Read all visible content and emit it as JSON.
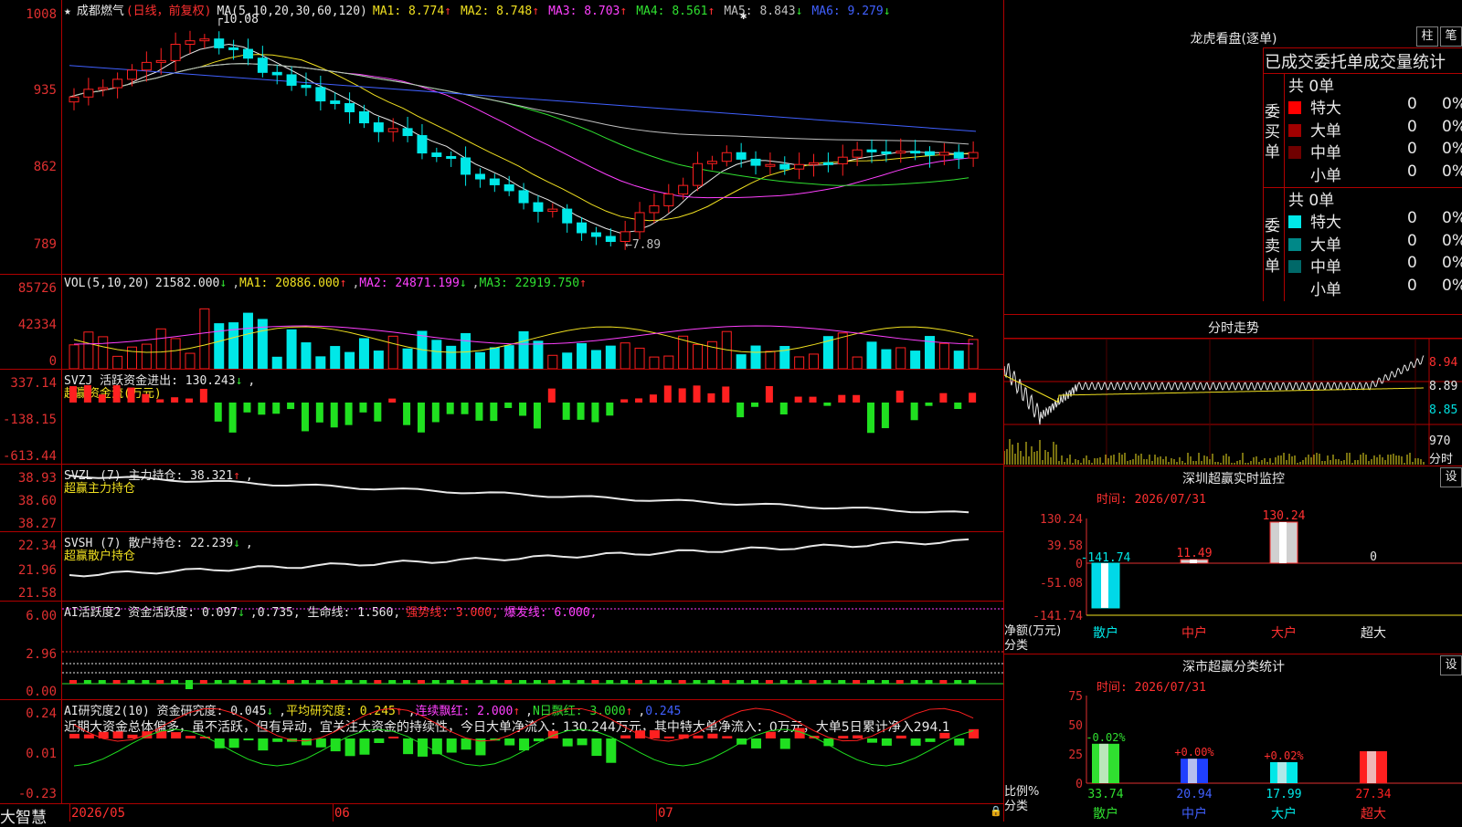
{
  "stock": {
    "name": "成都燃气",
    "mode": "(日线，前复权)",
    "ma_prefix": "MA(5,10,20,30,60,120)",
    "ma": [
      {
        "label": "MA1:",
        "value": "8.774",
        "arrow": "↑",
        "color": "#f0e020"
      },
      {
        "label": "MA2:",
        "value": "8.748",
        "arrow": "↑",
        "color": "#f0e020"
      },
      {
        "label": "MA3:",
        "value": "8.703",
        "arrow": "↑",
        "color": "#ff40ff"
      },
      {
        "label": "MA4:",
        "value": "8.561",
        "arrow": "↑",
        "color": "#30e030"
      },
      {
        "label": "MA5:",
        "value": "8.843",
        "arrow": "↓",
        "color": "#c0c0c0"
      },
      {
        "label": "MA6:",
        "value": "9.279",
        "arrow": "↓",
        "color": "#4060ff"
      }
    ],
    "high_label": "10.08",
    "low_label": "←7.89"
  },
  "price_axis": [
    "1008",
    "935",
    "862",
    "789"
  ],
  "vol": {
    "header": "VOL(5,10,20)",
    "value": "21582.000",
    "ma1": "MA1: 20886.000",
    "ma2": "MA2: 24871.199",
    "ma3": "MA3: 22919.750",
    "axis": [
      "85726",
      "42334",
      "0"
    ]
  },
  "svzj": {
    "header": "SVZJ  活跃资金进出: 130.243",
    "sub": "超赢资金流(万元)",
    "axis": [
      "337.14",
      "-138.15",
      "-613.44"
    ]
  },
  "svzl": {
    "header": "SVZL (7) 主力持仓: 38.321",
    "sub": "超赢主力持仓",
    "axis": [
      "38.93",
      "38.60",
      "38.27"
    ]
  },
  "svsh": {
    "header": "SVSH (7) 散户持仓: 22.239",
    "sub": "超赢散户持仓",
    "axis": [
      "22.34",
      "21.96",
      "21.58"
    ]
  },
  "ai1": {
    "header_a": "AI活跃度2 资金活跃度: 0.097",
    "header_b": "0.735, 生命线: 1.560,",
    "strong": "强势线: 3.000,",
    "burst": "爆发线: 6.000,",
    "axis": [
      "6.00",
      "2.96",
      "0.00"
    ]
  },
  "ai2": {
    "header_a": "AI研究度2(10) 资金研究度: 0.045",
    "avg": "平均研究度: 0.245",
    "cont": "连续飘红: 2.000",
    "nday": "N日飘红: 3.000",
    "last": "0.245",
    "text": "近期大资金总体偏多，虽不活跃，但有异动，宜关注大资金的持续性，今日大单净流入：130.244万元，其中特大单净流入：0万元，大单5日累计净入294.1",
    "axis": [
      "0.24",
      "0.01",
      "-0.23"
    ]
  },
  "bottom": {
    "brand": "大智慧",
    "dates": [
      "2026/05",
      "06",
      "07"
    ]
  },
  "dragon": {
    "title": "龙虎看盘(逐单)",
    "btn1": "柱",
    "btn2": "笔",
    "subtitle": "已成交委托单成交量统计",
    "buy_label": "委买单",
    "sell_label": "委卖单",
    "buy_total": "共 0单",
    "sell_total": "共 0单",
    "buy_rows": [
      {
        "name": "特大",
        "val": "0",
        "pct": "0%",
        "color": "#ff0000"
      },
      {
        "name": "大单",
        "val": "0",
        "pct": "0%",
        "color": "#a00000"
      },
      {
        "name": "中单",
        "val": "0",
        "pct": "0%",
        "color": "#700000"
      },
      {
        "name": "小单",
        "val": "0",
        "pct": "0%",
        "color": ""
      }
    ],
    "sell_rows": [
      {
        "name": "特大",
        "val": "0",
        "pct": "0%",
        "color": "#00e8e8"
      },
      {
        "name": "大单",
        "val": "0",
        "pct": "0%",
        "color": "#008888"
      },
      {
        "name": "中单",
        "val": "0",
        "pct": "0%",
        "color": "#006868"
      },
      {
        "name": "小单",
        "val": "0",
        "pct": "0%",
        "color": ""
      }
    ]
  },
  "intraday": {
    "title": "分时走势",
    "axis": [
      "8.94",
      "8.89",
      "8.85"
    ],
    "vol_label": "970",
    "vol_unit": "分时"
  },
  "sz_monitor": {
    "title": "深圳超赢实时监控",
    "btn": "设",
    "time": "时间: 2026/07/31",
    "axis": [
      "130.24",
      "39.58",
      "0",
      "-51.08",
      "-141.74"
    ],
    "y_label_1": "净额(万元)",
    "y_label_2": "分类",
    "cats": [
      "散户",
      "中户",
      "大户",
      "超大"
    ],
    "values": [
      "-141.74",
      "11.49",
      "130.24",
      "0"
    ]
  },
  "sz_class": {
    "title": "深市超赢分类统计",
    "btn": "设",
    "time": "时间: 2026/07/31",
    "axis": [
      "75",
      "50",
      "25",
      "0"
    ],
    "y_label_1": "比例%",
    "y_label_2": "分类",
    "cats": [
      "散户",
      "中户",
      "大户",
      "超大"
    ],
    "top_labels": [
      "-0.02%",
      "+0.00%",
      "+0.02%",
      ""
    ],
    "values": [
      "33.74",
      "20.94",
      "17.99",
      "27.34"
    ]
  },
  "chart_data": [
    {
      "type": "candlestick",
      "title": "成都燃气",
      "ylim": [
        7.6,
        10.2
      ],
      "yticks": [
        "1008",
        "935",
        "862",
        "789"
      ],
      "x_ticks": [
        "2026/05",
        "06",
        "07"
      ]
    },
    {
      "type": "bar",
      "title": "VOL(5,10,20)",
      "ylim": [
        0,
        85726
      ]
    },
    {
      "type": "bar",
      "title": "超赢资金流(万元)",
      "ylim": [
        -613.44,
        337.14
      ]
    },
    {
      "type": "bar",
      "title": "深圳超赢实时监控",
      "categories": [
        "散户",
        "中户",
        "大户",
        "超大"
      ],
      "values": [
        -141.74,
        11.49,
        130.24,
        0
      ],
      "ylim": [
        -141.74,
        130.24
      ]
    },
    {
      "type": "bar",
      "title": "深市超赢分类统计",
      "categories": [
        "散户",
        "中户",
        "大户",
        "超大"
      ],
      "values": [
        33.74,
        20.94,
        17.99,
        27.34
      ],
      "ylim": [
        0,
        75
      ]
    }
  ]
}
